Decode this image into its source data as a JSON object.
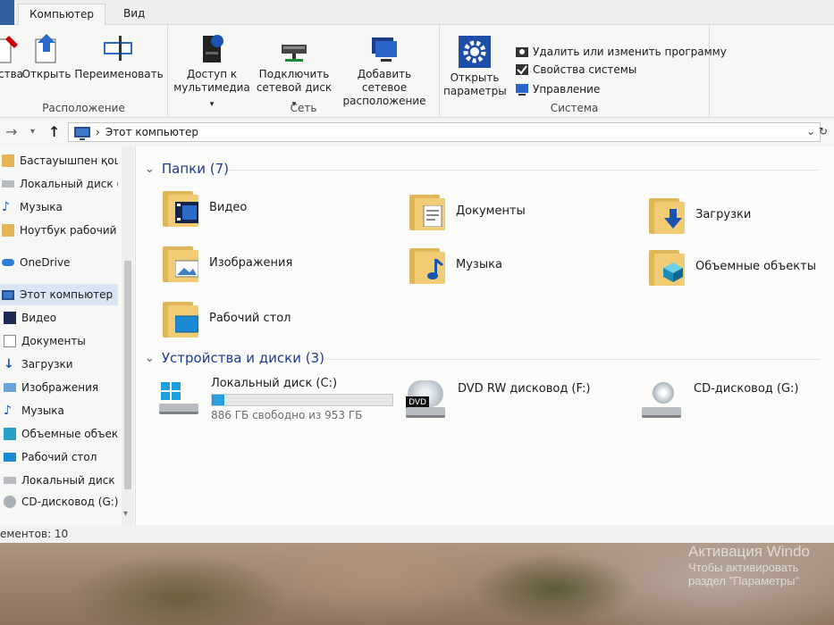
{
  "ribbon": {
    "tabs": {
      "active": "Компьютер",
      "view": "Вид"
    },
    "location": {
      "label": "Расположение",
      "properties": "Свойства",
      "open": "Открыть",
      "rename": "Переименовать"
    },
    "network": {
      "label": "Сеть",
      "media_access_1": "Доступ к",
      "media_access_2": "мультимедиа",
      "map_drive_1": "Подключить",
      "map_drive_2": "сетевой диск",
      "add_location_1": "Добавить сетевое",
      "add_location_2": "расположение"
    },
    "system": {
      "label": "Система",
      "open_settings_1": "Открыть",
      "open_settings_2": "параметры",
      "uninstall": "Удалить или изменить программу",
      "sys_props": "Свойства системы",
      "manage": "Управление"
    }
  },
  "address": {
    "path": "Этот компьютер"
  },
  "navpane": {
    "items": [
      {
        "label": "Бастауышпен қош",
        "icon": "folder-icon"
      },
      {
        "label": "Локальный диск (C",
        "icon": "drive-icon"
      },
      {
        "label": "Музыка",
        "icon": "music-icon"
      },
      {
        "label": "Ноутбук рабочий",
        "icon": "folder-icon"
      },
      {
        "label": "OneDrive",
        "icon": "cloud-icon"
      },
      {
        "label": "Этот компьютер",
        "icon": "computer-icon"
      },
      {
        "label": "Видео",
        "icon": "video-icon"
      },
      {
        "label": "Документы",
        "icon": "documents-icon"
      },
      {
        "label": "Загрузки",
        "icon": "downloads-icon"
      },
      {
        "label": "Изображения",
        "icon": "pictures-icon"
      },
      {
        "label": "Музыка",
        "icon": "music-icon"
      },
      {
        "label": "Объемные объект",
        "icon": "3d-objects-icon"
      },
      {
        "label": "Рабочий стол",
        "icon": "desktop-icon"
      },
      {
        "label": "Локальный диск (",
        "icon": "drive-icon"
      },
      {
        "label": "CD-дисковод (G:)",
        "icon": "cd-drive-icon"
      }
    ]
  },
  "folders": {
    "header": "Папки (7)",
    "items": [
      {
        "label": "Видео"
      },
      {
        "label": "Документы"
      },
      {
        "label": "Загрузки"
      },
      {
        "label": "Изображения"
      },
      {
        "label": "Музыка"
      },
      {
        "label": "Объемные объекты"
      },
      {
        "label": "Рабочий стол"
      }
    ]
  },
  "drives": {
    "header": "Устройства и диски (3)",
    "local": {
      "label": "Локальный диск (C:)",
      "free": "886 ГБ свободно из 953 ГБ",
      "used_fraction": 0.07
    },
    "dvd": {
      "label": "DVD RW дисковод (F:)",
      "badge": "DVD"
    },
    "cd": {
      "label": "CD-дисковод (G:)"
    }
  },
  "status": {
    "count": "ементов: 10"
  },
  "activation": {
    "title": "Активация Windo",
    "line1": "Чтобы активировать",
    "line2": "раздел \"Параметры\""
  },
  "colors": {
    "accent": "#26a0da",
    "heading": "#1f3a93",
    "folder": "#f2cc73"
  }
}
